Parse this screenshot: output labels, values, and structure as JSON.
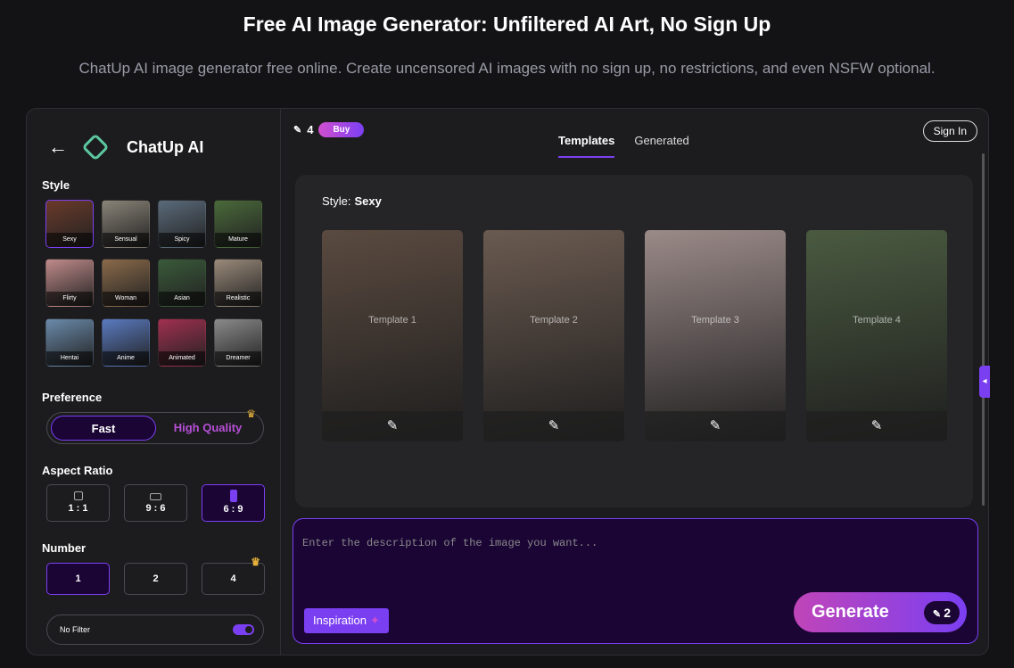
{
  "hero": {
    "title": "Free AI Image Generator: Unfiltered AI Art, No Sign Up",
    "subtitle": "ChatUp AI image generator free online. Create uncensored AI images with no sign up, no restrictions, and even NSFW optional."
  },
  "sidebar": {
    "back_icon": "arrow-left-icon",
    "brand": "ChatUp AI",
    "style_label": "Style",
    "styles": [
      {
        "label": "Sexy",
        "color": "#6a3a2a",
        "selected": true
      },
      {
        "label": "Sensual",
        "color": "#8a8478"
      },
      {
        "label": "Spicy",
        "color": "#5a6a7a"
      },
      {
        "label": "Mature",
        "color": "#4a6a3a"
      },
      {
        "label": "Flirty",
        "color": "#c08a8a"
      },
      {
        "label": "Woman",
        "color": "#8a6a4a"
      },
      {
        "label": "Asian",
        "color": "#3a5a3a"
      },
      {
        "label": "Realistic",
        "color": "#9a8a7a"
      },
      {
        "label": "Hentai",
        "color": "#6a8aaa"
      },
      {
        "label": "Anime",
        "color": "#5a7ac0"
      },
      {
        "label": "Animated",
        "color": "#a03050"
      },
      {
        "label": "Dreamer",
        "color": "#8a8a8a"
      }
    ],
    "preference_label": "Preference",
    "preference_options": [
      "Fast",
      "High Quality"
    ],
    "preference_selected": "Fast",
    "aspect_label": "Aspect Ratio",
    "aspect_options": [
      "1 : 1",
      "9 : 6",
      "6 : 9"
    ],
    "aspect_selected": "6 : 9",
    "number_label": "Number",
    "number_options": [
      "1",
      "2",
      "4"
    ],
    "number_selected": "1",
    "filter_label": "No Filter",
    "filter_on": true
  },
  "main": {
    "credits": "4",
    "buy_label": "Buy",
    "tabs": [
      "Templates",
      "Generated"
    ],
    "active_tab": "Templates",
    "signin_label": "Sign In",
    "style_prefix": "Style:",
    "style_value": "Sexy",
    "templates": [
      {
        "label": "Template 1",
        "color": "#5a4a40"
      },
      {
        "label": "Template 2",
        "color": "#6a5a50"
      },
      {
        "label": "Template 3",
        "color": "#9a8a88"
      },
      {
        "label": "Template 4",
        "color": "#4a5a40"
      }
    ],
    "prompt_placeholder": "Enter the description of the image you want...",
    "inspiration_label": "Inspiration",
    "generate_label": "Generate",
    "generate_cost": "2"
  }
}
